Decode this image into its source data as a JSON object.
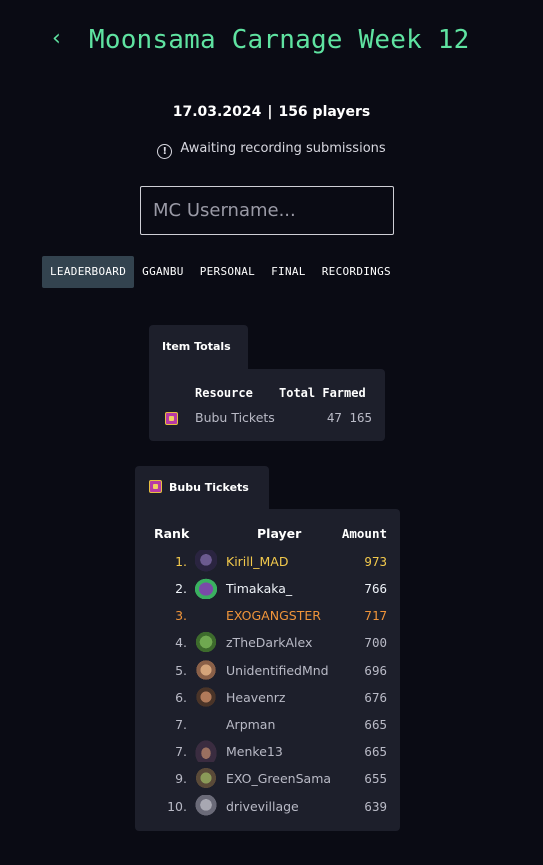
{
  "header": {
    "back_icon": "chevron-left-icon",
    "title": "Moonsama Carnage Week 12"
  },
  "meta": {
    "date": "17.03.2024",
    "separator": "|",
    "players": "156 players"
  },
  "status": {
    "icon": "info-circle-icon",
    "text": "Awaiting recording submissions"
  },
  "search": {
    "placeholder": "MC Username..."
  },
  "tabs": [
    {
      "label": "LEADERBOARD",
      "active": true
    },
    {
      "label": "GGANBU",
      "active": false
    },
    {
      "label": "PERSONAL",
      "active": false
    },
    {
      "label": "FINAL",
      "active": false
    },
    {
      "label": "RECORDINGS",
      "active": false
    }
  ],
  "item_totals": {
    "tab_label": "Item Totals",
    "headers": {
      "resource": "Resource",
      "total": "Total Farmed"
    },
    "rows": [
      {
        "icon": "bubu-ticket-icon",
        "resource": "Bubu Tickets",
        "total": "47 165"
      }
    ]
  },
  "bubu_tickets": {
    "tab_label": "Bubu Tickets",
    "tab_icon": "bubu-ticket-icon",
    "headers": {
      "rank": "Rank",
      "player": "Player",
      "amount": "Amount"
    },
    "rows": [
      {
        "rank": "1.",
        "player": "Kirill_MAD",
        "amount": "973",
        "tier": "gold"
      },
      {
        "rank": "2.",
        "player": "Timakaka_",
        "amount": "766",
        "tier": "silver"
      },
      {
        "rank": "3.",
        "player": "EXOGANGSTER",
        "amount": "717",
        "tier": "bronze"
      },
      {
        "rank": "4.",
        "player": "zTheDarkAlex",
        "amount": "700",
        "tier": ""
      },
      {
        "rank": "5.",
        "player": "UnidentifiedMnd",
        "amount": "696",
        "tier": ""
      },
      {
        "rank": "6.",
        "player": "Heavenrz",
        "amount": "676",
        "tier": ""
      },
      {
        "rank": "7.",
        "player": "Arpman",
        "amount": "665",
        "tier": ""
      },
      {
        "rank": "7.",
        "player": "Menke13",
        "amount": "665",
        "tier": ""
      },
      {
        "rank": "9.",
        "player": "EXO_GreenSama",
        "amount": "655",
        "tier": ""
      },
      {
        "rank": "10.",
        "player": "drivevillage",
        "amount": "639",
        "tier": ""
      }
    ]
  }
}
